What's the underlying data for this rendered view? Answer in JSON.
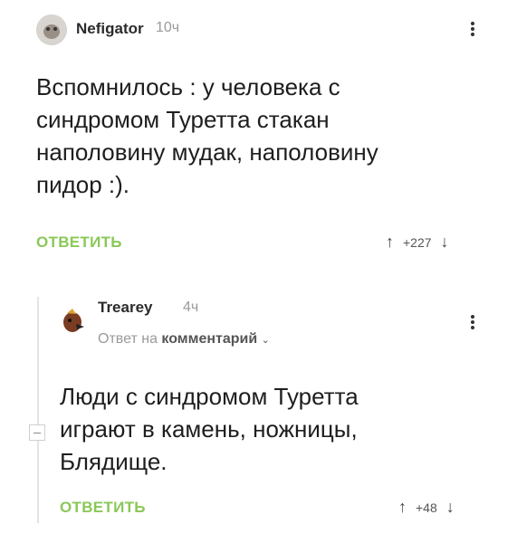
{
  "comment1": {
    "username": "Nefigator",
    "time": "10ч",
    "text": "Вспомнилось : у человека с\nсиндромом Туретта стакан\nнаполовину мудак, наполовину\nпидор :).",
    "reply_label": "ОТВЕТИТЬ",
    "rating": "+227"
  },
  "comment2": {
    "username": "Trearey",
    "time": "4ч",
    "reply_to_prefix": "Ответ на",
    "reply_to_link": "комментарий",
    "text": "Люди с синдромом Туретта\nиграют в камень, ножницы,\nБлядище.",
    "reply_label": "ОТВЕТИТЬ",
    "rating": "+48"
  },
  "icons": {
    "up": "arrow-up-icon",
    "down": "arrow-down-icon",
    "more": "kebab-menu-icon"
  },
  "colors": {
    "reply_green": "#8ac858",
    "meta_gray": "#9a9a9a"
  }
}
